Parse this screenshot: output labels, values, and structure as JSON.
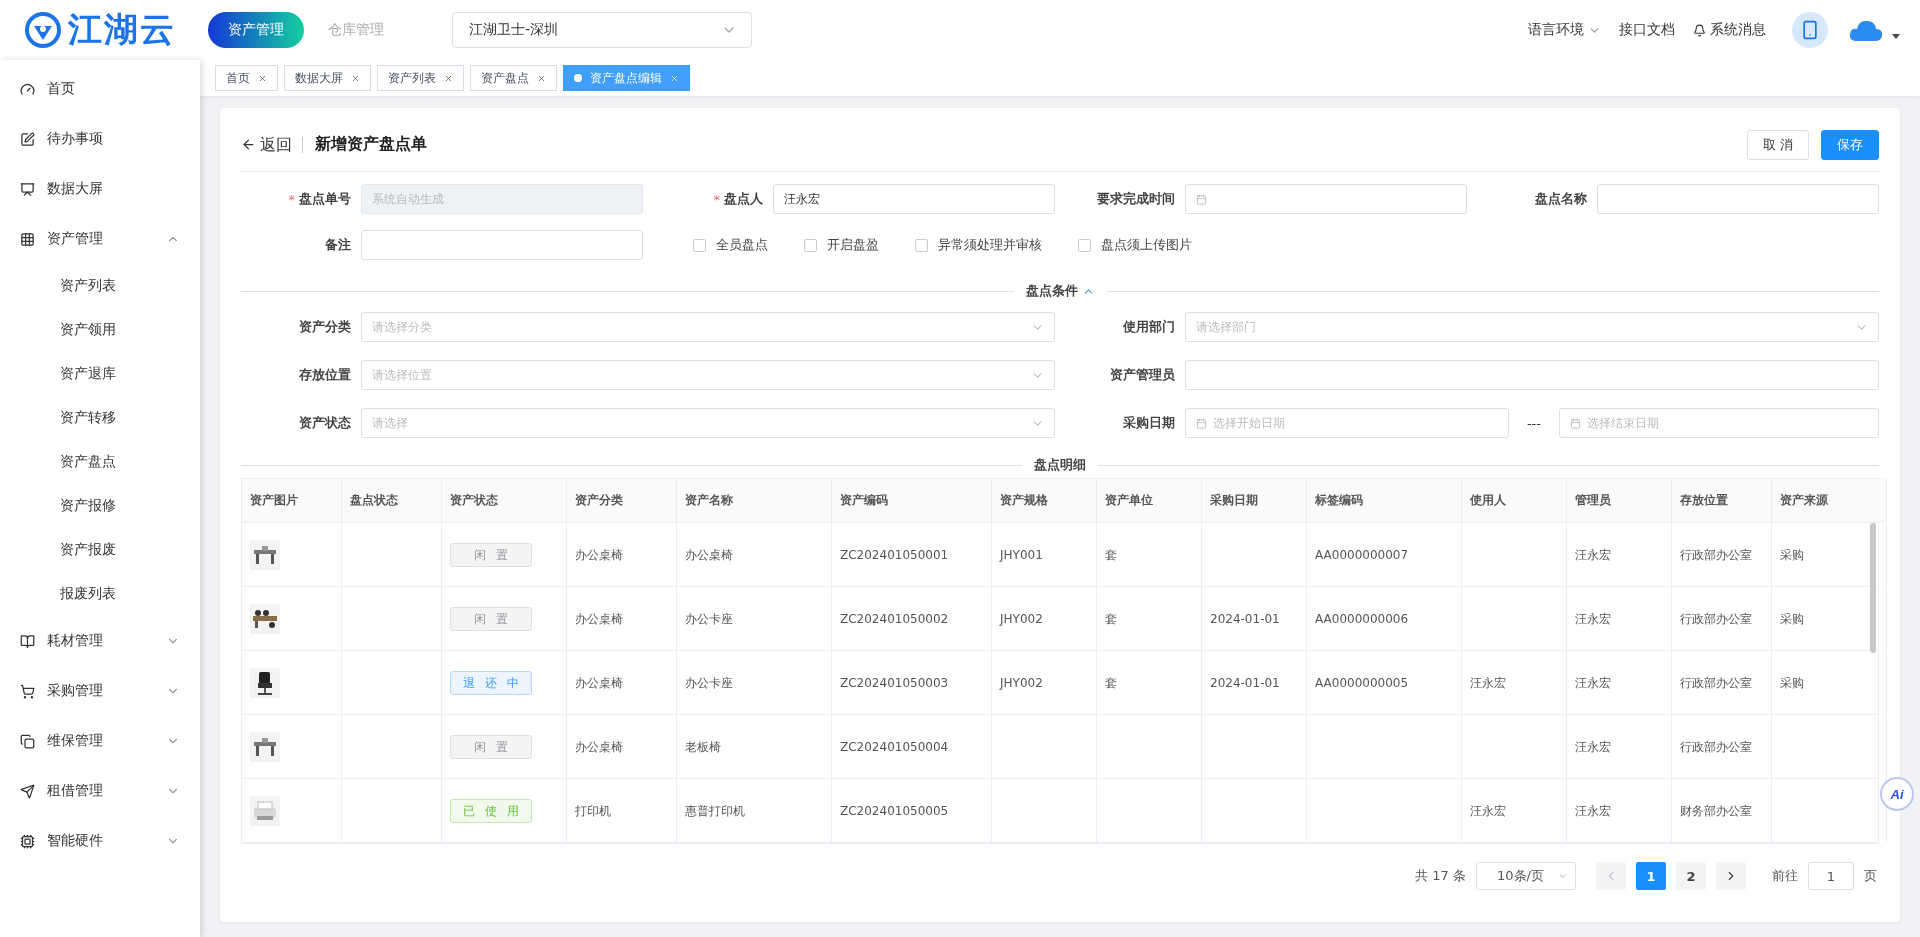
{
  "header": {
    "logo": "江湖云",
    "nav": [
      {
        "label": "资产管理",
        "selected": true
      },
      {
        "label": "仓库管理",
        "selected": false
      }
    ],
    "org_select": "江湖卫士-深圳",
    "links": [
      {
        "kind": "dropdown",
        "label": "语言环境"
      },
      {
        "kind": "link",
        "label": "接口文档"
      },
      {
        "kind": "bell",
        "label": "系统消息"
      }
    ]
  },
  "sidebar": {
    "items": [
      {
        "label": "首页"
      },
      {
        "label": "待办事项"
      },
      {
        "label": "数据大屏"
      },
      {
        "label": "资产管理",
        "expanded": true,
        "children": [
          {
            "label": "资产列表"
          },
          {
            "label": "资产领用"
          },
          {
            "label": "资产退库"
          },
          {
            "label": "资产转移"
          },
          {
            "label": "资产盘点"
          },
          {
            "label": "资产报修"
          },
          {
            "label": "资产报废"
          },
          {
            "label": "报废列表"
          }
        ]
      },
      {
        "label": "耗材管理",
        "expanded": false
      },
      {
        "label": "采购管理",
        "expanded": false
      },
      {
        "label": "维保管理",
        "expanded": false
      },
      {
        "label": "租借管理",
        "expanded": false
      },
      {
        "label": "智能硬件",
        "expanded": false
      }
    ]
  },
  "tabs": [
    {
      "label": "首页",
      "selected": false
    },
    {
      "label": "数据大屏",
      "selected": false
    },
    {
      "label": "资产列表",
      "selected": false
    },
    {
      "label": "资产盘点",
      "selected": false
    },
    {
      "label": "资产盘点编辑",
      "selected": true
    }
  ],
  "page": {
    "back": "返回",
    "title": "新增资产盘点单",
    "buttons": [
      {
        "kind": "default",
        "label": "取 消"
      },
      {
        "kind": "primary",
        "label": "保存"
      }
    ]
  },
  "form": {
    "required_mark": "*",
    "fields": [
      {
        "label": "盘点单号",
        "required": true,
        "kind": "text",
        "disabled": true,
        "placeholder": "系统自动生成"
      },
      {
        "label": "盘点人",
        "required": true,
        "kind": "text",
        "disabled": false,
        "value": "汪永宏"
      },
      {
        "label": "要求完成时间",
        "required": false,
        "kind": "date",
        "disabled": false
      },
      {
        "label": "盘点名称",
        "required": false,
        "kind": "text",
        "disabled": false
      },
      {
        "label": "备注",
        "required": false,
        "kind": "text",
        "disabled": false
      }
    ],
    "checkboxes": [
      {
        "label": "全员盘点",
        "checked": false
      },
      {
        "label": "开启盘盈",
        "checked": false
      },
      {
        "label": "异常须处理并审核",
        "checked": false
      },
      {
        "label": "盘点须上传图片",
        "checked": false
      }
    ]
  },
  "conditions": {
    "title": "盘点条件",
    "expanded": true,
    "fields": [
      {
        "label": "资产分类",
        "kind": "select",
        "placeholder": "请选择分类"
      },
      {
        "label": "使用部门",
        "kind": "select",
        "placeholder": "请选择部门"
      },
      {
        "label": "存放位置",
        "kind": "select",
        "placeholder": "请选择位置"
      },
      {
        "label": "资产管理员",
        "kind": "text"
      },
      {
        "label": "资产状态",
        "kind": "select",
        "placeholder": "请选择"
      },
      {
        "label": "采购日期",
        "kind": "daterange",
        "separator": "---",
        "start_placeholder": "选择开始日期",
        "end_placeholder": "选择结束日期"
      }
    ]
  },
  "details": {
    "title": "盘点明细",
    "columns": [
      "资产图片",
      "盘点状态",
      "资产状态",
      "资产分类",
      "资产名称",
      "资产编码",
      "资产规格",
      "资产单位",
      "采购日期",
      "标签编码",
      "使用人",
      "管理员",
      "存放位置",
      "资产来源"
    ],
    "rows": [
      {
        "status": {
          "kind": "idle",
          "label": "闲置"
        },
        "category": "办公桌椅",
        "name": "办公桌椅",
        "code": "ZC202401050001",
        "spec": "JHY001",
        "unit": "套",
        "tag_code": "AA0000000007",
        "manager": "汪永宏",
        "location": "行政部办公室",
        "source": "采购"
      },
      {
        "status": {
          "kind": "idle",
          "label": "闲置"
        },
        "category": "办公桌椅",
        "name": "办公卡座",
        "code": "ZC202401050002",
        "spec": "JHY002",
        "unit": "套",
        "purchase_date": "2024-01-01",
        "tag_code": "AA0000000006",
        "manager": "汪永宏",
        "location": "行政部办公室",
        "source": "采购"
      },
      {
        "status": {
          "kind": "returning",
          "label": "退还中"
        },
        "category": "办公桌椅",
        "name": "办公卡座",
        "code": "ZC202401050003",
        "spec": "JHY002",
        "unit": "套",
        "purchase_date": "2024-01-01",
        "tag_code": "AA0000000005",
        "user": "汪永宏",
        "manager": "汪永宏",
        "location": "行政部办公室",
        "source": "采购"
      },
      {
        "status": {
          "kind": "idle",
          "label": "闲置"
        },
        "category": "办公桌椅",
        "name": "老板椅",
        "code": "ZC202401050004",
        "manager": "汪永宏",
        "location": "行政部办公室"
      },
      {
        "status": {
          "kind": "used",
          "label": "已使用"
        },
        "category": "打印机",
        "name": "惠普打印机",
        "code": "ZC202401050005",
        "user": "汪永宏",
        "manager": "汪永宏",
        "location": "财务部办公室"
      }
    ]
  },
  "pagination": {
    "total": "共 17 条",
    "page_size": "10条/页",
    "prev_disabled": true,
    "next_disabled": false,
    "pages": [
      {
        "label": "1",
        "selected": true
      },
      {
        "label": "2",
        "selected": false
      }
    ],
    "goto_label": "前往",
    "goto_value": "1",
    "goto_suffix": "页"
  },
  "assistant_button": "Ai"
}
